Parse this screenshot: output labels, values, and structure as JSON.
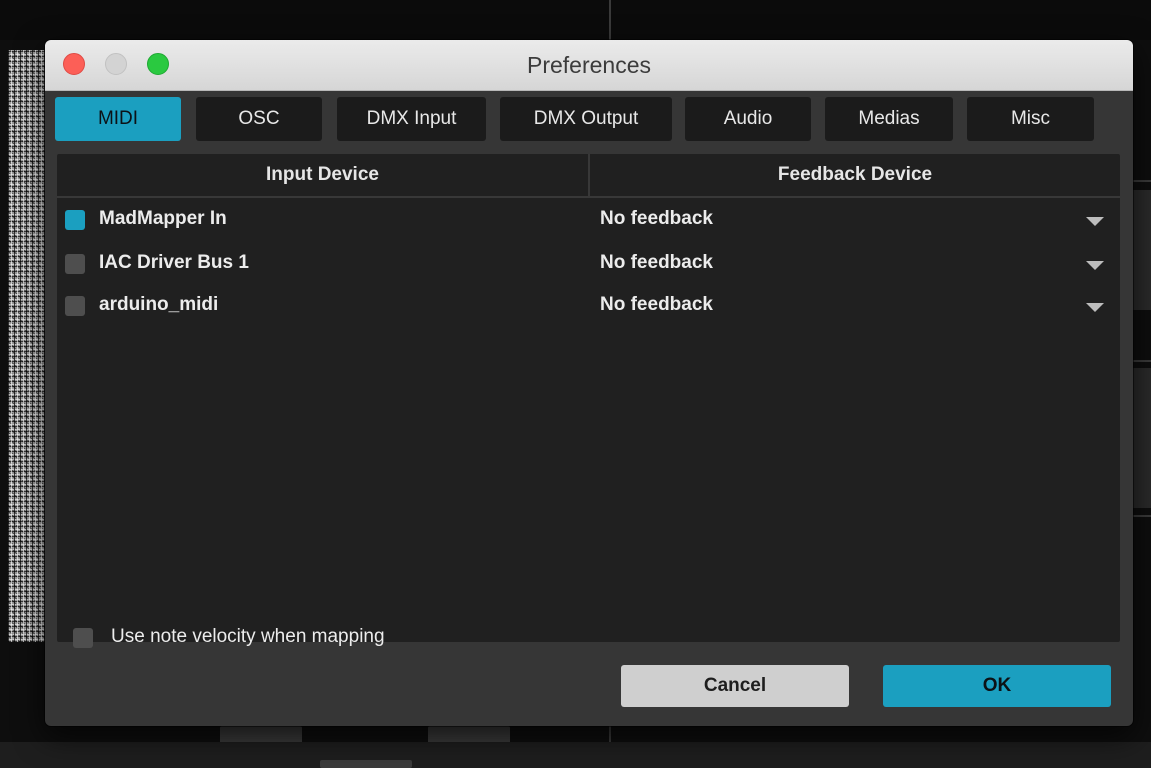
{
  "window": {
    "title": "Preferences"
  },
  "tabs": [
    {
      "label": "MIDI",
      "active": true
    },
    {
      "label": "OSC",
      "active": false
    },
    {
      "label": "DMX Input",
      "active": false
    },
    {
      "label": "DMX Output",
      "active": false
    },
    {
      "label": "Audio",
      "active": false
    },
    {
      "label": "Medias",
      "active": false
    },
    {
      "label": "Misc",
      "active": false
    }
  ],
  "table": {
    "headers": {
      "input": "Input Device",
      "feedback": "Feedback Device"
    },
    "rows": [
      {
        "device": "MadMapper In",
        "enabled": true,
        "feedback": "No feedback"
      },
      {
        "device": "IAC Driver Bus 1",
        "enabled": false,
        "feedback": "No feedback"
      },
      {
        "device": "arduino_midi",
        "enabled": false,
        "feedback": "No feedback"
      }
    ]
  },
  "options": {
    "velocity_label": "Use note velocity when mapping",
    "velocity_checked": false
  },
  "buttons": {
    "cancel": "Cancel",
    "ok": "OK"
  },
  "colors": {
    "accent": "#1b9fc0",
    "panel": "#202020",
    "dialog": "#363636"
  },
  "icons": {
    "window_close": "close-dot",
    "window_minimize": "minimize-dot",
    "window_zoom": "zoom-dot",
    "dropdown": "caret-down"
  }
}
